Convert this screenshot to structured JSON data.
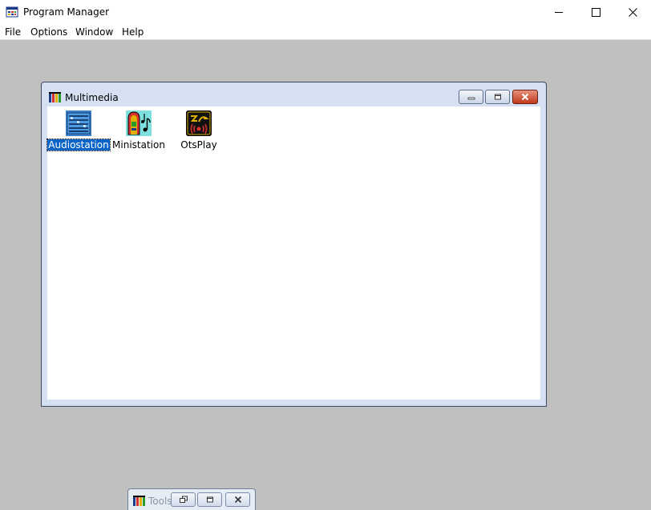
{
  "app": {
    "title": "Program Manager",
    "icon": "program-manager-icon"
  },
  "menu": [
    "File",
    "Options",
    "Window",
    "Help"
  ],
  "window_controls": [
    "minimize-icon",
    "maximize-icon",
    "close-icon"
  ],
  "multimedia_window": {
    "title": "Multimedia",
    "icon": "program-group-icon",
    "controls": [
      "minimize-icon",
      "restore-icon",
      "close-icon"
    ],
    "programs": [
      {
        "label": "Audiostation",
        "icon": "audiostation-icon",
        "selected": true
      },
      {
        "label": "Ministation",
        "icon": "ministation-icon",
        "selected": false
      },
      {
        "label": "OtsPlay",
        "icon": "otsplay-icon",
        "selected": false
      }
    ]
  },
  "tools_window": {
    "title": "Tools",
    "icon": "program-group-icon",
    "state": "minimized",
    "controls": [
      "restore-icon",
      "maximize-icon",
      "close-icon"
    ]
  },
  "colors": {
    "desktop": "#c0c0c0",
    "selection": "#0a64c8",
    "close_button": "#c0391b"
  }
}
